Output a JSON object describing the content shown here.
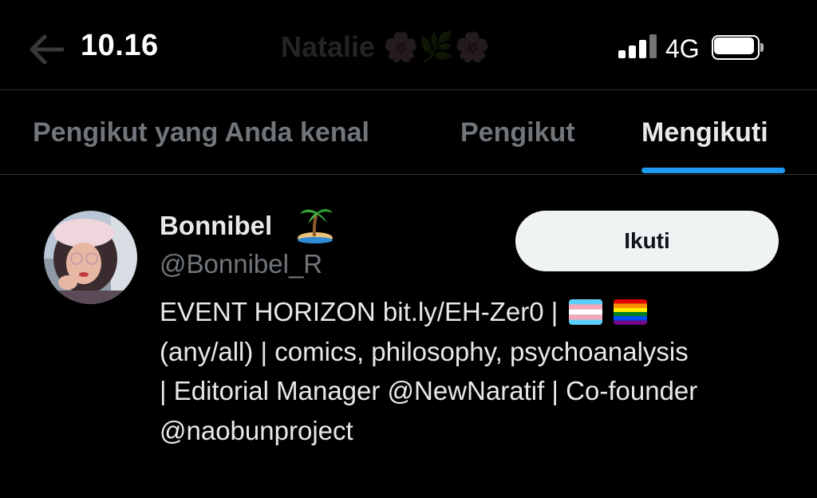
{
  "status_bar": {
    "time": "10.16",
    "network": "4G"
  },
  "header": {
    "title": "Natalie 🌸🌿🌸"
  },
  "tabs": [
    {
      "label": "Pengikut yang Anda kenal",
      "active": false
    },
    {
      "label": "Pengikut",
      "active": false
    },
    {
      "label": "Mengikuti",
      "active": true
    }
  ],
  "user": {
    "display_name": "Bonnibel",
    "name_emoji": "desert-island-icon",
    "handle": "@Bonnibel_R",
    "follow_label": "Ikuti",
    "bio_lines": [
      "EVENT HORIZON bit.ly/EH-Zer0 |",
      "(any/all) | comics, philosophy, psychoanalysis",
      "| Editorial Manager @NewNaratif | Co-founder",
      "@naobunproject"
    ],
    "bio_flags": [
      "transgender-flag-icon",
      "rainbow-flag-icon"
    ]
  },
  "colors": {
    "background": "#000000",
    "accent": "#1d9bf0",
    "text_primary": "#e7e9ea",
    "text_secondary": "#71767b",
    "button_bg": "#eff3f4"
  }
}
